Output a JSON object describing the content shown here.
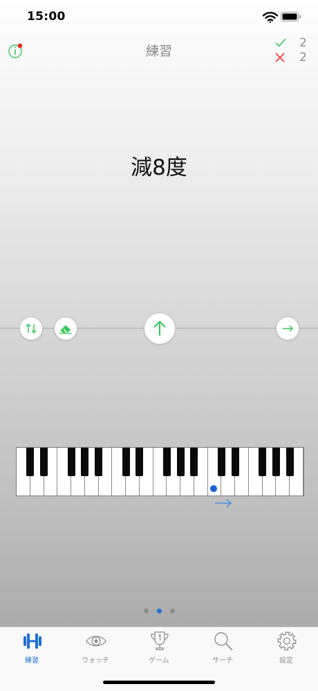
{
  "status_bar": {
    "time": "15:00"
  },
  "nav": {
    "title": "練習"
  },
  "score": {
    "correct": "2",
    "wrong": "2"
  },
  "question": {
    "text": "減8度"
  },
  "colors": {
    "accent_green": "#34c759",
    "wrong_red": "#ff3b30",
    "tab_active_blue": "#1f6fd8",
    "marker_blue": "#1a63d6"
  },
  "controls": [
    {
      "icon": "swap-arrows-icon"
    },
    {
      "icon": "eraser-icon"
    },
    {
      "icon": "arrow-up-icon"
    },
    {
      "icon": "arrow-right-icon"
    }
  ],
  "pager": {
    "count": 3,
    "active": 2
  },
  "tabs": [
    {
      "label": "練習",
      "icon": "dumbbell-icon",
      "active": true
    },
    {
      "label": "ウォッチ",
      "icon": "eye-icon",
      "active": false
    },
    {
      "label": "ゲーム",
      "icon": "trophy-icon",
      "active": false
    },
    {
      "label": "サーチ",
      "icon": "magnifier-icon",
      "active": false
    },
    {
      "label": "設定",
      "icon": "gear-icon",
      "active": false
    }
  ]
}
